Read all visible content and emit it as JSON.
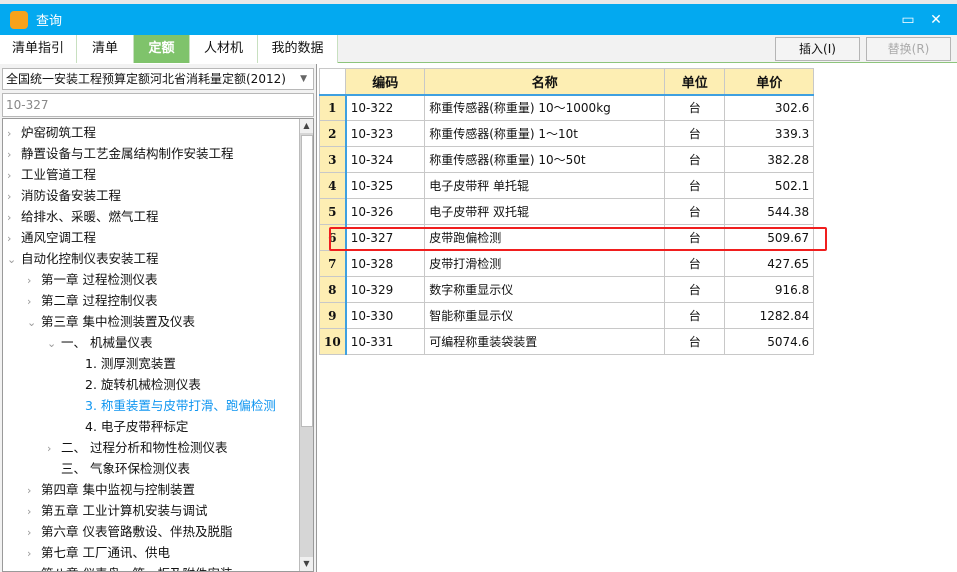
{
  "window": {
    "title": "查询",
    "logo": "✓"
  },
  "tabs": [
    {
      "label": "清单指引"
    },
    {
      "label": "清单"
    },
    {
      "label": "定额",
      "active": true
    },
    {
      "label": "人材机"
    },
    {
      "label": "我的数据"
    }
  ],
  "buttons": {
    "insert": "插入(I)",
    "replace": "替换(R)"
  },
  "left": {
    "library": "全国统一安装工程预算定额河北省消耗量定额(2012)",
    "search_value": "10-327"
  },
  "tree": [
    {
      "label": "炉窑砌筑工程",
      "level": 0,
      "state": "collapsed"
    },
    {
      "label": "静置设备与工艺金属结构制作安装工程",
      "level": 0,
      "state": "collapsed"
    },
    {
      "label": "工业管道工程",
      "level": 0,
      "state": "collapsed"
    },
    {
      "label": "消防设备安装工程",
      "level": 0,
      "state": "collapsed"
    },
    {
      "label": "给排水、采暖、燃气工程",
      "level": 0,
      "state": "collapsed"
    },
    {
      "label": "通风空调工程",
      "level": 0,
      "state": "collapsed"
    },
    {
      "label": "自动化控制仪表安装工程",
      "level": 0,
      "state": "expanded"
    },
    {
      "label": "第一章  过程检测仪表",
      "level": 1,
      "state": "collapsed"
    },
    {
      "label": "第二章  过程控制仪表",
      "level": 1,
      "state": "collapsed"
    },
    {
      "label": "第三章  集中检测装置及仪表",
      "level": 1,
      "state": "expanded"
    },
    {
      "label": "一、  机械量仪表",
      "level": 2,
      "state": "expanded"
    },
    {
      "label": "1.  测厚测宽装置",
      "level": 3,
      "state": "leaf"
    },
    {
      "label": "2.  旋转机械检测仪表",
      "level": 3,
      "state": "leaf"
    },
    {
      "label": "3.  称重装置与皮带打滑、跑偏检测",
      "level": 3,
      "state": "leaf",
      "selected": true
    },
    {
      "label": "4.  电子皮带秤标定",
      "level": 3,
      "state": "leaf"
    },
    {
      "label": "二、  过程分析和物性检测仪表",
      "level": 2,
      "state": "collapsed"
    },
    {
      "label": "三、  气象环保检测仪表",
      "level": 2,
      "state": "leaf"
    },
    {
      "label": "第四章  集中监视与控制装置",
      "level": 1,
      "state": "collapsed"
    },
    {
      "label": "第五章  工业计算机安装与调试",
      "level": 1,
      "state": "collapsed"
    },
    {
      "label": "第六章  仪表管路敷设、伴热及脱脂",
      "level": 1,
      "state": "collapsed"
    },
    {
      "label": "第七章  工厂通讯、供电",
      "level": 1,
      "state": "collapsed"
    },
    {
      "label": "第八章  仪表盘、箱、柜及附件安装",
      "level": 1,
      "state": "collapsed"
    }
  ],
  "table": {
    "headers": [
      "编码",
      "名称",
      "单位",
      "单价"
    ],
    "rows": [
      [
        "1",
        "10-322",
        "称重传感器(称重量) 10～1000kg",
        "台",
        "302.6"
      ],
      [
        "2",
        "10-323",
        "称重传感器(称重量) 1～10t",
        "台",
        "339.3"
      ],
      [
        "3",
        "10-324",
        "称重传感器(称重量) 10～50t",
        "台",
        "382.28"
      ],
      [
        "4",
        "10-325",
        "电子皮带秤 单托辊",
        "台",
        "502.1"
      ],
      [
        "5",
        "10-326",
        "电子皮带秤 双托辊",
        "台",
        "544.38"
      ],
      [
        "6",
        "10-327",
        "皮带跑偏检测",
        "台",
        "509.67"
      ],
      [
        "7",
        "10-328",
        "皮带打滑检测",
        "台",
        "427.65"
      ],
      [
        "8",
        "10-329",
        "数字称重显示仪",
        "台",
        "916.8"
      ],
      [
        "9",
        "10-330",
        "智能称重显示仪",
        "台",
        "1282.84"
      ],
      [
        "10",
        "10-331",
        "可编程称重装袋装置",
        "台",
        "5074.6"
      ]
    ],
    "highlighted_row": 6
  }
}
